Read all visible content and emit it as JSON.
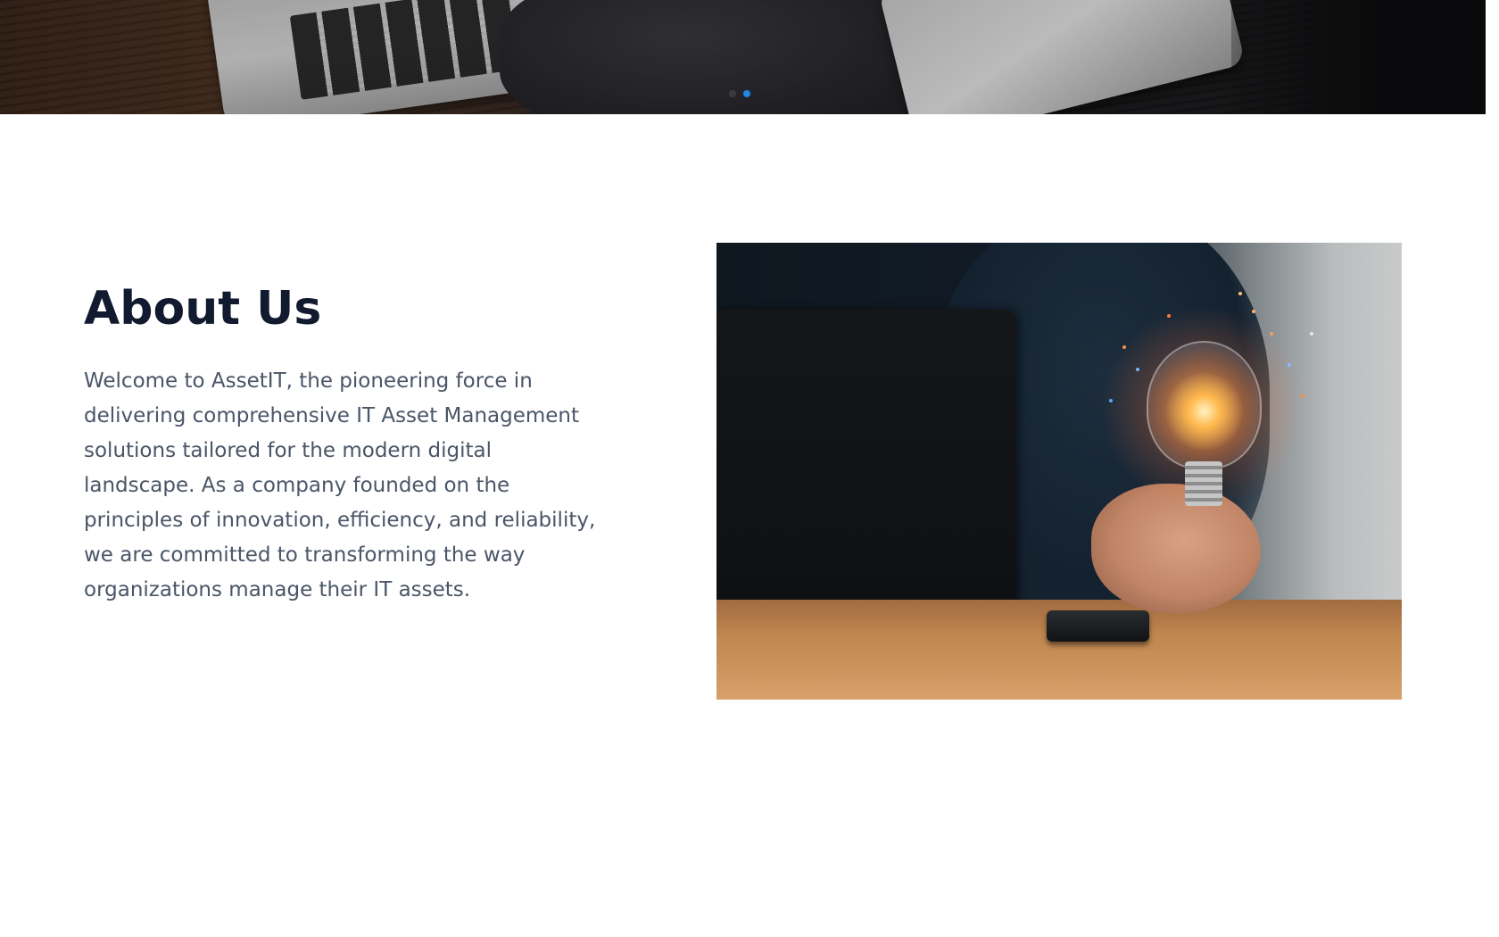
{
  "hero": {
    "image_name": "laptop-typing-banner",
    "carousel": {
      "slide_count": 2,
      "active_index": 1,
      "active_color": "#1e88e5",
      "inactive_color": "#3b3b3b"
    }
  },
  "about": {
    "title": "About Us",
    "text": "Welcome to AssetIT, the pioneering force in delivering comprehensive IT Asset Management solutions tailored for the modern digital landscape. As a company founded on the principles of innovation, efficiency, and reliability, we are committed to transforming the way organizations manage their IT assets.",
    "image_name": "lightbulb-in-hand-photo"
  },
  "colors": {
    "heading": "#111a2e",
    "body_text": "#4a5567"
  }
}
